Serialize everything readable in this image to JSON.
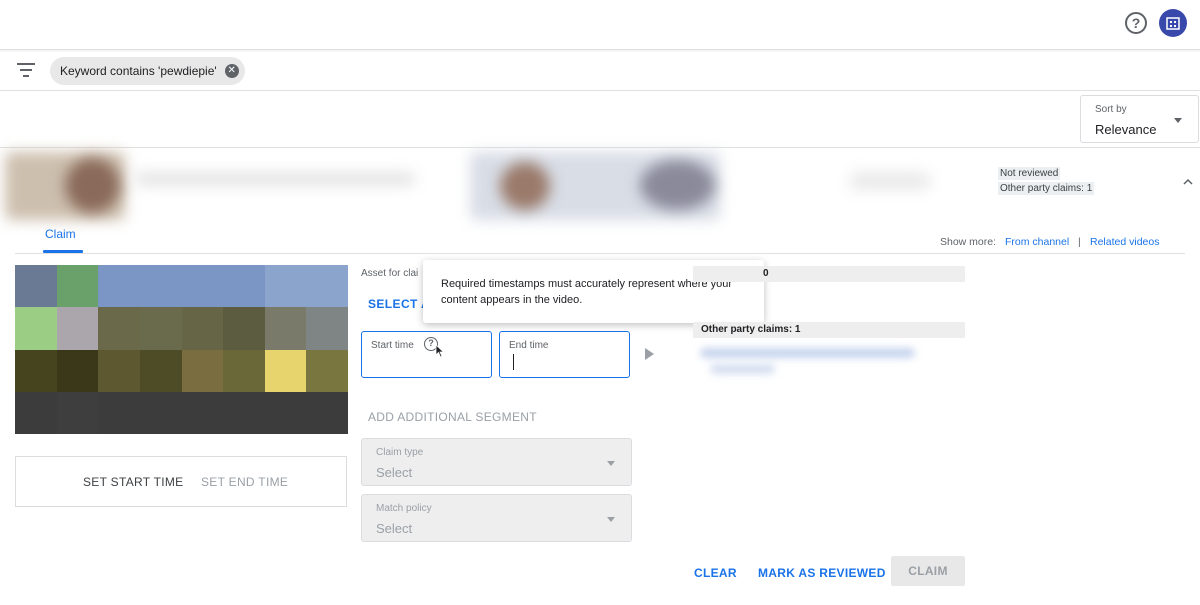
{
  "header": {
    "help_icon": "help-circle-icon",
    "avatar_icon": "channel-avatar-icon"
  },
  "filter": {
    "icon": "filter-list-icon",
    "chip_label": "Keyword contains 'pewdiepie'",
    "chip_close_icon": "close-circle-icon"
  },
  "sort": {
    "label": "Sort by",
    "value": "Relevance"
  },
  "video": {
    "status": "Not reviewed",
    "other_claims": "Other party claims: 1",
    "collapse_icon": "chevron-up-icon"
  },
  "tabs": {
    "claim": "Claim",
    "show_more": "Show more:",
    "from_channel": "From channel",
    "separator": "|",
    "related_videos": "Related videos"
  },
  "player": {
    "set_start": "SET START TIME",
    "set_end": "SET END TIME",
    "thumb_colors": [
      "#6b7a94",
      "#6aa06a",
      "#7b96c4",
      "#7b96c4",
      "#7b96c4",
      "#7b96c4",
      "#8aa4cc",
      "#8aa4cc",
      "#9ccd84",
      "#aaa6ab",
      "#6a6a4a",
      "#6a6a4c",
      "#666646",
      "#5c5c40",
      "#7a7a6a",
      "#7f8484",
      "#46441e",
      "#3a3818",
      "#5e5830",
      "#4e4c26",
      "#7a6e40",
      "#6a6838",
      "#e8d46c",
      "#7a7640",
      "#3c3c3c",
      "#3e3e3e",
      "#3c3c3c",
      "#3c3c3c",
      "#3c3c3c",
      "#3c3c3c",
      "#3c3c3c",
      "#3c3c3c"
    ]
  },
  "claim_form": {
    "asset_label": "Asset for clai",
    "select_asset": "SELECT AS",
    "tooltip": "Required timestamps must accurately represent where your content appears in the video.",
    "start_time_label": "Start time",
    "end_time_label": "End time",
    "add_segment": "ADD ADDITIONAL SEGMENT",
    "claim_type_label": "Claim type",
    "claim_type_value": "Select",
    "match_policy_label": "Match policy",
    "match_policy_value": "Select"
  },
  "right_panel": {
    "bar1_text": "0",
    "bar2_text": "Other party claims: 1"
  },
  "actions": {
    "clear": "CLEAR",
    "mark_reviewed": "MARK AS REVIEWED",
    "claim": "CLAIM"
  },
  "colors": {
    "accent": "#1a73e8",
    "avatar": "#3949ab"
  }
}
